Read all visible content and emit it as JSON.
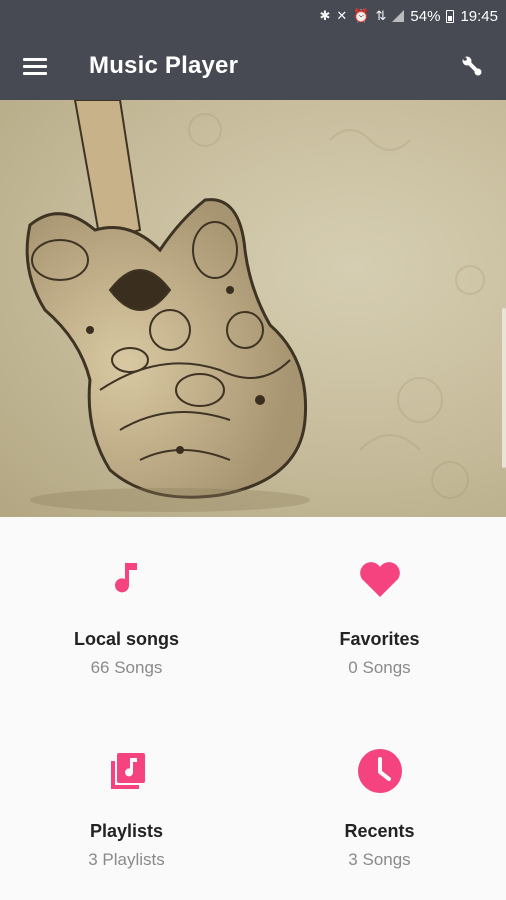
{
  "status_bar": {
    "battery": "54%",
    "time": "19:45"
  },
  "toolbar": {
    "title": "Music Player",
    "menu_icon": "menu-icon",
    "action_icon": "settings-wrench-icon"
  },
  "colors": {
    "toolbar": "#474a53",
    "accent": "#f4437f",
    "background": "#fafafa"
  },
  "tiles": [
    {
      "icon": "music-note-icon",
      "title": "Local songs",
      "subtitle": "66 Songs"
    },
    {
      "icon": "heart-icon",
      "title": "Favorites",
      "subtitle": "0 Songs"
    },
    {
      "icon": "playlist-icon",
      "title": "Playlists",
      "subtitle": "3 Playlists"
    },
    {
      "icon": "clock-icon",
      "title": "Recents",
      "subtitle": "3 Songs"
    }
  ]
}
